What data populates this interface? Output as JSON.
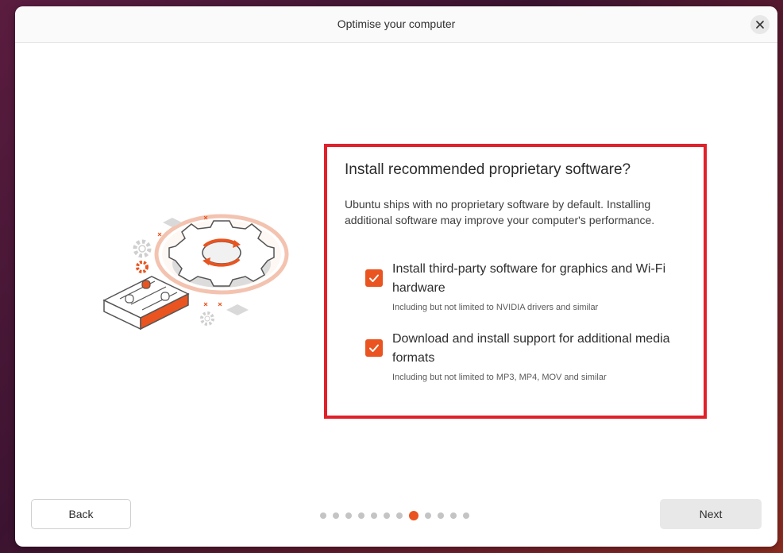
{
  "window": {
    "title": "Optimise your computer"
  },
  "icons": {
    "close": "close-icon",
    "checkmark": "checkmark-icon",
    "illustration": "settings-gear-illustration"
  },
  "colors": {
    "accent": "#e95420",
    "highlight_border": "#e0202b"
  },
  "card": {
    "heading": "Install recommended proprietary software?",
    "description": "Ubuntu ships with no proprietary software by default. Installing additional software may improve your computer's performance.",
    "options": [
      {
        "label": "Install third-party software for graphics and Wi-Fi hardware",
        "sub": "Including but not limited to NVIDIA drivers and similar",
        "checked": true
      },
      {
        "label": "Download and install support for additional media formats",
        "sub": "Including but not limited to MP3, MP4, MOV and similar",
        "checked": true
      }
    ]
  },
  "footer": {
    "back_label": "Back",
    "next_label": "Next",
    "progress": {
      "total_steps": 12,
      "current_step": 8
    }
  }
}
